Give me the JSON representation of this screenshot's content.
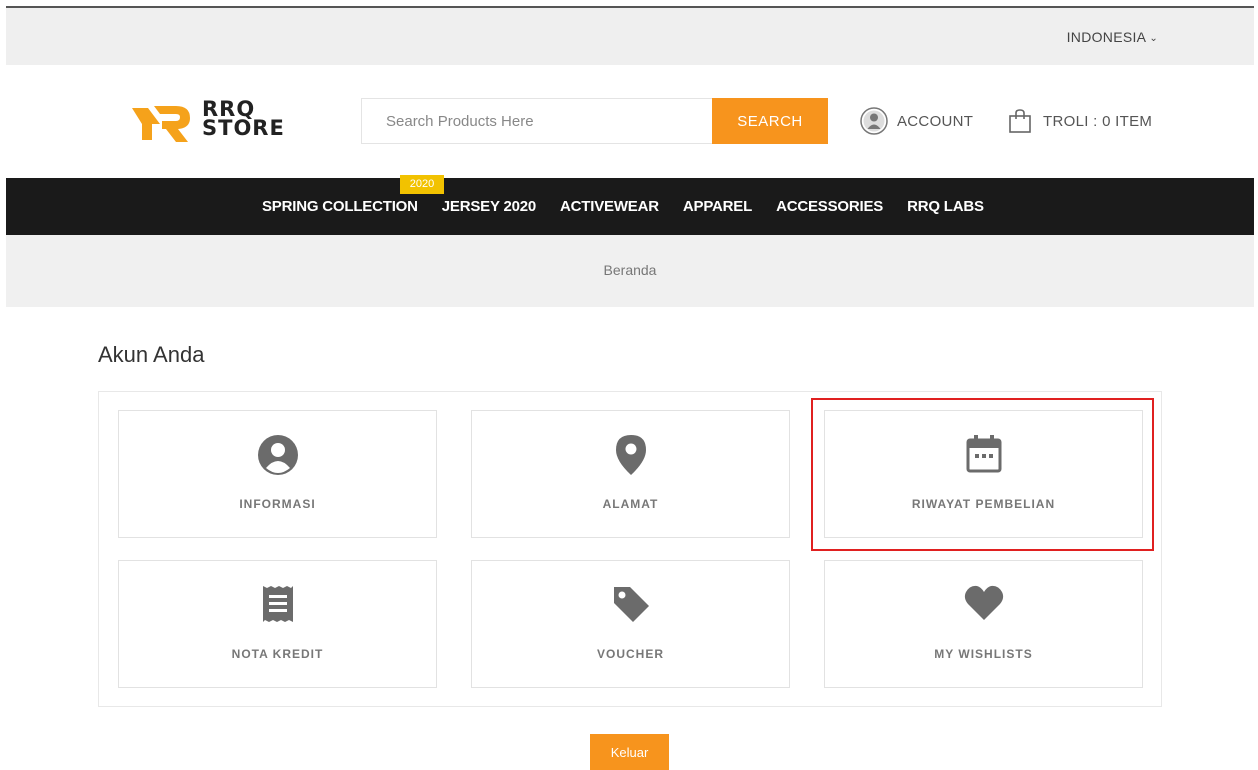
{
  "topbar": {
    "language": "INDONESIA"
  },
  "header": {
    "logo_line1": "RRQ",
    "logo_line2": "STORE",
    "search_placeholder": "Search Products Here",
    "search_button": "SEARCH",
    "account_label": "ACCOUNT",
    "cart_label": "TROLI : 0 ITEM"
  },
  "nav": {
    "badge": "2020",
    "items": [
      {
        "label": "SPRING COLLECTION"
      },
      {
        "label": "JERSEY 2020"
      },
      {
        "label": "ACTIVEWEAR"
      },
      {
        "label": "APPAREL"
      },
      {
        "label": "ACCESSORIES"
      },
      {
        "label": "RRQ LABS"
      }
    ]
  },
  "breadcrumb": {
    "home": "Beranda"
  },
  "page": {
    "title": "Akun Anda",
    "tiles": [
      {
        "label": "INFORMASI",
        "icon": "user-circle-icon"
      },
      {
        "label": "ALAMAT",
        "icon": "map-pin-icon"
      },
      {
        "label": "RIWAYAT PEMBELIAN",
        "icon": "calendar-icon"
      },
      {
        "label": "NOTA KREDIT",
        "icon": "receipt-icon"
      },
      {
        "label": "VOUCHER",
        "icon": "tag-icon"
      },
      {
        "label": "MY WISHLISTS",
        "icon": "heart-icon"
      }
    ],
    "logout": "Keluar"
  },
  "colors": {
    "accent": "#f7941d",
    "nav_bg": "#1a1a1a",
    "badge": "#f2c200",
    "highlight": "#e02020",
    "icon": "#6b6b6b"
  }
}
